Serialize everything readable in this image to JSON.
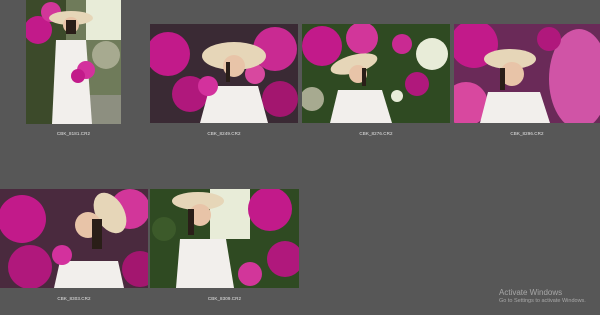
{
  "gallery": {
    "photos": [
      {
        "filename": "CBK_8181.CR2",
        "variant": "standing-bouquet"
      },
      {
        "filename": "CBK_8249.CR2",
        "variant": "hat-hands"
      },
      {
        "filename": "CBK_8276.CR2",
        "variant": "hat-tilt"
      },
      {
        "filename": "CBK_8296.CR2",
        "variant": "hat-closeup-pink-blur"
      },
      {
        "filename": "CBK_8303.CR2",
        "variant": "profile-flowers"
      },
      {
        "filename": "CBK_8309.CR2",
        "variant": "hat-look-right"
      }
    ]
  },
  "windows_watermark": {
    "title": "Activate Windows",
    "subtitle": "Go to Settings to activate Windows."
  },
  "colors": {
    "background": "#575757",
    "magenta": "#c21a8a",
    "dress": "#f2efec",
    "hat": "#e6d6b8",
    "foliage": "#2f4a22"
  }
}
